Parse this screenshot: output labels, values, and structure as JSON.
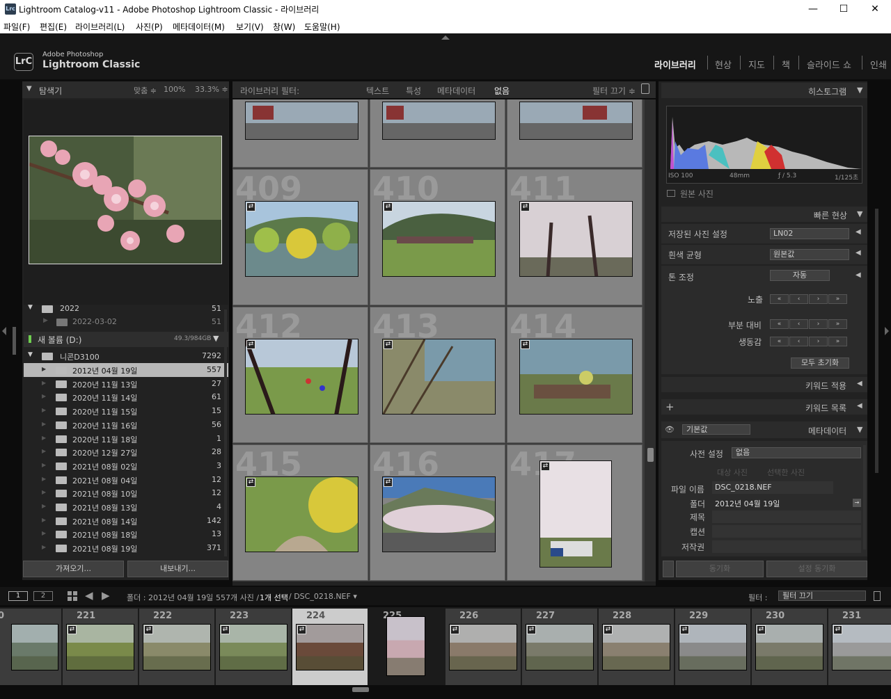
{
  "window": {
    "title": "Lightroom Catalog-v11 - Adobe Photoshop Lightroom Classic - 라이브러리",
    "icon": "Lrc",
    "minimize": "—",
    "maximize": "☐",
    "close": "✕"
  },
  "menu": [
    "파일(F)",
    "편집(E)",
    "라이브러리(L)",
    "사진(P)",
    "메타데이터(M)",
    "보기(V)",
    "창(W)",
    "도움말(H)"
  ],
  "brand": {
    "badge": "LrC",
    "line1": "Adobe Photoshop",
    "line2": "Lightroom Classic"
  },
  "modules": [
    "라이브러리",
    "현상",
    "지도",
    "책",
    "슬라이드 쇼",
    "인쇄"
  ],
  "active_module": "라이브러리",
  "navigator": {
    "title": "탐색기",
    "fit": "맞춤 ≑",
    "zoom1": "100%",
    "zoom2": "33.3% ≑"
  },
  "folders": {
    "year": {
      "name": "2022",
      "count": "51"
    },
    "sub": {
      "name": "2022-03-02",
      "count": "51"
    },
    "volume": {
      "name": "새 볼륨 (D:)",
      "size": "49.3/984GB"
    },
    "camera": {
      "name": "니콘D3100",
      "count": "7292"
    },
    "items": [
      {
        "name": "2012년 04월 19일",
        "count": "557"
      },
      {
        "name": "2020년 11월 13일",
        "count": "27"
      },
      {
        "name": "2020년 11월 14일",
        "count": "61"
      },
      {
        "name": "2020년 11월 15일",
        "count": "15"
      },
      {
        "name": "2020년 11월 16일",
        "count": "56"
      },
      {
        "name": "2020년 11월 18일",
        "count": "1"
      },
      {
        "name": "2020년 12월 27일",
        "count": "28"
      },
      {
        "name": "2021년 08월 02일",
        "count": "3"
      },
      {
        "name": "2021년 08월 04일",
        "count": "12"
      },
      {
        "name": "2021년 08월 10일",
        "count": "12"
      },
      {
        "name": "2021년 08월 13일",
        "count": "4"
      },
      {
        "name": "2021년 08월 14일",
        "count": "142"
      },
      {
        "name": "2021년 08월 18일",
        "count": "13"
      },
      {
        "name": "2021년 08월 19일",
        "count": "371"
      }
    ]
  },
  "left_buttons": {
    "import": "가져오기...",
    "export": "내보내기..."
  },
  "filter_bar": {
    "label": "라이브러리 필터:",
    "text": "텍스트",
    "attr": "특성",
    "meta": "메타데이터",
    "none": "없음",
    "filter_off": "필터 끄기 ≑"
  },
  "grid_cells": [
    {
      "num": "409"
    },
    {
      "num": "410"
    },
    {
      "num": "411"
    },
    {
      "num": "412"
    },
    {
      "num": "413"
    },
    {
      "num": "414"
    },
    {
      "num": "415"
    },
    {
      "num": "416"
    },
    {
      "num": "417"
    }
  ],
  "right": {
    "histogram": "히스토그램",
    "iso": "ISO 100",
    "focal": "48mm",
    "aperture": "ƒ / 5.3",
    "shutter": "1/125초",
    "original_photo": "원본 사진",
    "quick_develop": "빠른 현상",
    "saved_preset_label": "저장된 사진 설정",
    "saved_preset_value": "LN02",
    "white_balance_label": "흰색 균형",
    "white_balance_value": "원본값",
    "tone_label": "톤 조정",
    "auto": "자동",
    "exposure": "노출",
    "clarity": "부분 대비",
    "vibrance": "생동감",
    "reset_all": "모두 초기화",
    "keyword_apply": "키워드 적용",
    "keyword_list": "키워드 목록",
    "metadata_preset": "기본값",
    "metadata": "메타데이터",
    "preset_label": "사전 설정",
    "preset_value": "없음",
    "target_photo": "대상 사진",
    "selected_photos": "선택한 사진",
    "filename_label": "파일 이름",
    "filename_value": "DSC_0218.NEF",
    "folder_label": "폴더",
    "folder_value": "2012년 04월 19일",
    "title_label": "제목",
    "caption_label": "캡션",
    "copyright_label": "저작권",
    "sync": "동기화",
    "sync_settings": "설정 동기화"
  },
  "filmbar": {
    "screen1": "1",
    "screen2": "2",
    "path": "폴더 : 2012년 04월 19일",
    "count": "557개 사진 /",
    "selected": "1개 선택",
    "file": "/ DSC_0218.NEF ▾",
    "filter_label": "필터 :",
    "filter_value": "필터 끄기"
  },
  "filmstrip": [
    "0",
    "221",
    "222",
    "223",
    "224",
    "225",
    "226",
    "227",
    "228",
    "229",
    "230",
    "231"
  ]
}
